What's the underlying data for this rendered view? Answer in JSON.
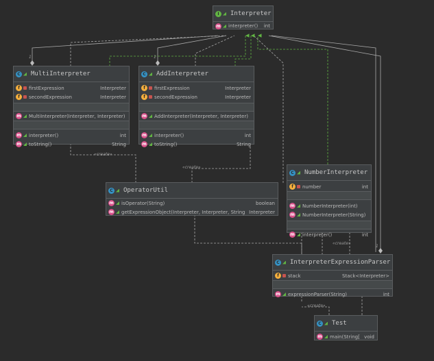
{
  "classes": {
    "interpreter": {
      "name": "Interpreter",
      "methods": [
        {
          "name": "interpreter()",
          "type": "int"
        }
      ]
    },
    "multi": {
      "name": "MultiInterpreter",
      "fields": [
        {
          "name": "firstExpression",
          "type": "Interpreter"
        },
        {
          "name": "secondExpression",
          "type": "Interpreter"
        }
      ],
      "constructors": [
        {
          "name": "MultiInterpreter(Interpreter, Interpreter)",
          "type": ""
        }
      ],
      "methods": [
        {
          "name": "interpreter()",
          "type": "int"
        },
        {
          "name": "toString()",
          "type": "String"
        }
      ]
    },
    "add": {
      "name": "AddInterpreter",
      "fields": [
        {
          "name": "firstExpression",
          "type": "Interpreter"
        },
        {
          "name": "secondExpression",
          "type": "Interpreter"
        }
      ],
      "constructors": [
        {
          "name": "AddInterpreter(Interpreter, Interpreter)",
          "type": ""
        }
      ],
      "methods": [
        {
          "name": "interpreter()",
          "type": "int"
        },
        {
          "name": "toString()",
          "type": "String"
        }
      ]
    },
    "number": {
      "name": "NumberInterpreter",
      "fields": [
        {
          "name": "number",
          "type": "int"
        }
      ],
      "constructors": [
        {
          "name": "NumberInterpreter(int)",
          "type": ""
        },
        {
          "name": "NumberInterpreter(String)",
          "type": ""
        }
      ],
      "methods": [
        {
          "name": "interpreter()",
          "type": "int"
        }
      ]
    },
    "operator": {
      "name": "OperatorUtil",
      "methods": [
        {
          "name": "isOperator(String)",
          "type": "boolean"
        },
        {
          "name": "getExpressionObject(Interpreter, Interpreter, String)",
          "type": "Interpreter"
        }
      ]
    },
    "parser": {
      "name": "InterpreterExpressionParser",
      "fields": [
        {
          "name": "stack",
          "type": "Stack<Interpreter>"
        }
      ],
      "methods": [
        {
          "name": "expressionParser(String)",
          "type": "int"
        }
      ]
    },
    "test": {
      "name": "Test",
      "methods": [
        {
          "name": "main(String[])",
          "type": "void"
        }
      ]
    }
  },
  "labels": {
    "create": "«create»",
    "one": "1"
  },
  "colors": {
    "background": "#2b2b2b",
    "box": "#3c3f41",
    "border": "#5a5d5f",
    "realization": "#62b543",
    "dependency": "#aaaaaa"
  }
}
